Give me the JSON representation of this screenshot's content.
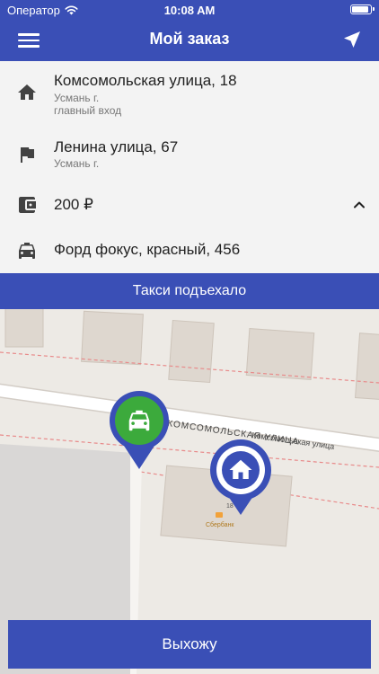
{
  "status_bar": {
    "carrier": "Оператор",
    "time": "10:08 AM",
    "battery_level": 0.95
  },
  "header": {
    "title": "Мой заказ",
    "menu_icon": "hamburger-menu-icon",
    "locate_icon": "location-arrow-icon"
  },
  "order": {
    "pickup": {
      "icon": "home-icon",
      "address": "Комсомольская улица, 18",
      "city": "Усмань г.",
      "note": "главный вход"
    },
    "destination": {
      "icon": "flag-icon",
      "address": "Ленина улица, 67",
      "city": "Усмань г."
    },
    "price": {
      "icon": "wallet-icon",
      "value": "200 ₽",
      "toggle_icon": "chevron-up-icon"
    },
    "car": {
      "icon": "car-icon",
      "description": "Форд фокус, красный, 456"
    }
  },
  "status_banner": "Такси подъехало",
  "map": {
    "street_label_1": "КОМСОМОЛЬСКАЯ УЛИЦА",
    "street_label_2": "Комсомольская улица",
    "house_number": "18",
    "poi_label": "Сбербанк",
    "taxi_marker_icon": "taxi-icon",
    "home_marker_icon": "home-icon",
    "colors": {
      "accent": "#3a4fb6",
      "taxi_green": "#3caa3c"
    }
  },
  "exit_button": "Выхожу"
}
